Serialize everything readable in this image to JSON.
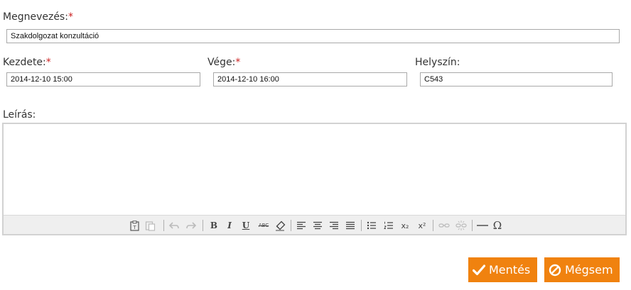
{
  "form": {
    "name_label": "Megnevezés:",
    "name_value": "Szakdolgozat konzultáció",
    "start_label": "Kezdete:",
    "start_value": "2014-12-10 15:00",
    "end_label": "Vége:",
    "end_value": "2014-12-10 16:00",
    "location_label": "Helyszín:",
    "location_value": "C543",
    "description_label": "Leírás:",
    "required_mark": "*"
  },
  "toolbar": {
    "bold": "B",
    "italic": "I",
    "underline": "U",
    "strike": "ABC",
    "subscript": "x₂",
    "superscript": "x²",
    "special_char": "Ω"
  },
  "actions": {
    "save_label": "Mentés",
    "cancel_label": "Mégsem"
  },
  "colors": {
    "accent": "#f0820f",
    "required": "#cc2222"
  }
}
